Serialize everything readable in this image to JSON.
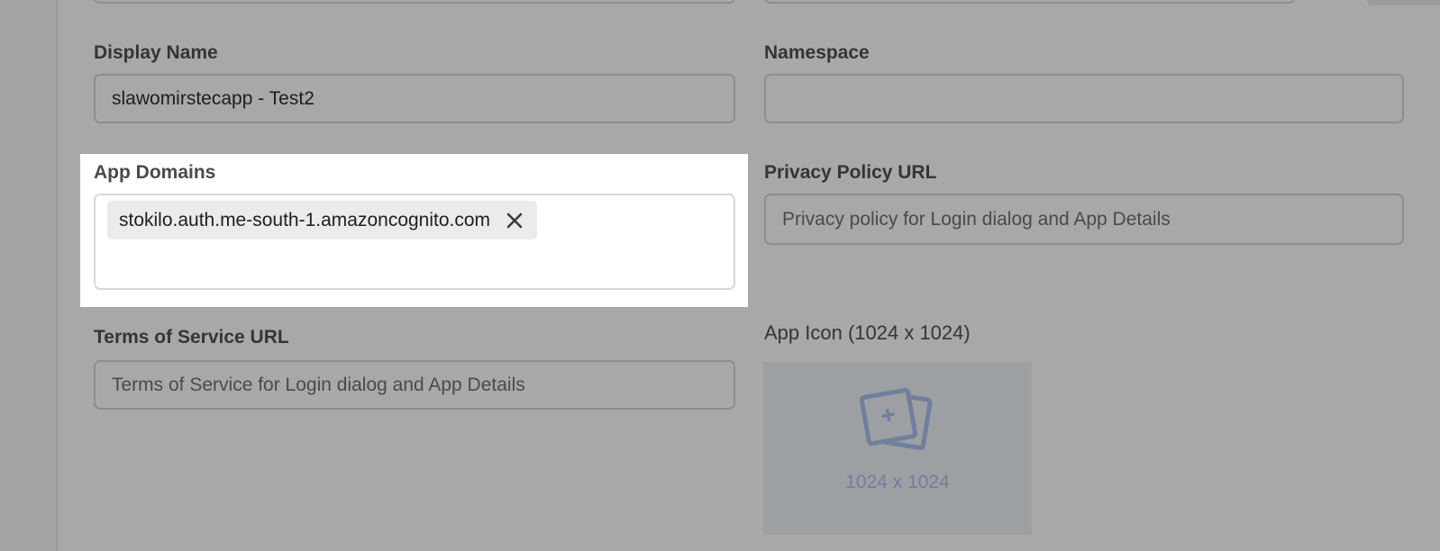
{
  "form": {
    "display_name": {
      "label": "Display Name",
      "value": "slawomirstecapp - Test2"
    },
    "namespace": {
      "label": "Namespace",
      "value": ""
    },
    "app_domains": {
      "label": "App Domains",
      "tags": [
        "stokilo.auth.me-south-1.amazoncognito.com"
      ]
    },
    "privacy_policy_url": {
      "label": "Privacy Policy URL",
      "placeholder": "Privacy policy for Login dialog and App Details"
    },
    "terms_of_service_url": {
      "label": "Terms of Service URL",
      "placeholder": "Terms of Service for Login dialog and App Details"
    },
    "app_icon": {
      "label": "App Icon (1024 x 1024)",
      "size_text": "1024 x 1024"
    }
  },
  "colors": {
    "dim_overlay": "#a8a8a8",
    "highlight_bg": "#ffffff",
    "tag_bg": "#ebebeb",
    "upload_accent": "#6f7f9d"
  },
  "icons": {
    "tag_remove": "close-icon",
    "upload": "image-add-icon"
  }
}
